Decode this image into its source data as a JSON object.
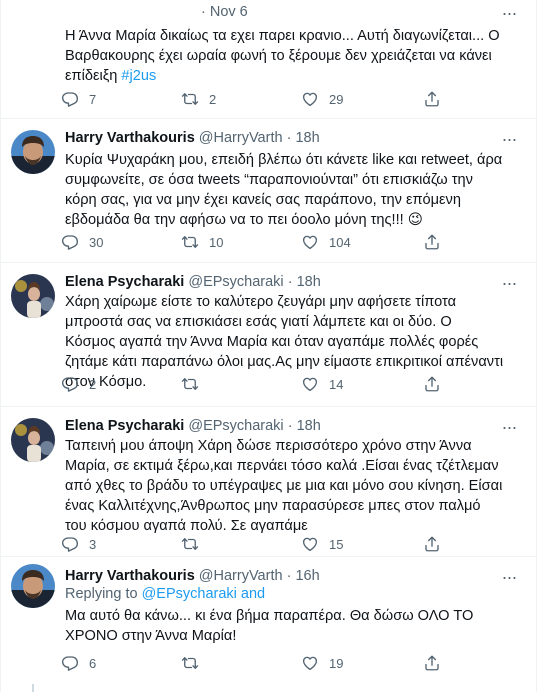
{
  "tweets": [
    {
      "time": "Nov 6",
      "text_before": "Η Άννα Μαρία δικαίως τα εχει παρει κρανιο... Αυτή διαγωνίζεται... Ο Βαρθακουρης έχει ωραία φωνή το ξέρουμε δεν χρειάζεται να κάνει επίδειξη ",
      "hashtag": "#j2us",
      "replies": "7",
      "retweets": "2",
      "likes": "29"
    },
    {
      "name": "Harry Varthakouris",
      "handle": "@HarryVarth",
      "time": "18h",
      "text": "Κυρία Ψυχαράκη μου, επειδή βλέπω ότι κάνετε like και retweet, άρα συμφωνείτε,  σε όσα tweets “παραπονιούνται” ότι επισκιάζω την κόρη σας, για να μην έχει κανείς σας παράπονο, την επόμενη εβδομάδα θα την αφήσω να το πει όοολο μόνη της!!! 😉",
      "replies": "30",
      "retweets": "10",
      "likes": "104"
    },
    {
      "name": "Elena Psycharaki",
      "handle": "@EPsycharaki",
      "time": "18h",
      "text": "Χάρη χαίρωμε είστε το καλύτερο  ζευγάρι μην αφήσετε τίποτα μπροστά σας να επισκιάσει εσάς  γιατί λάμπετε και οι δύο.               Ο Κόσμος αγαπά την Άννα Μαρία και όταν αγαπάμε πολλές φορές ζητάμε κάτι παραπάνω όλοι μας.Ας μην είμαστε επικριτικοί απέναντι στον Κόσμο.",
      "replies": "2",
      "retweets": "",
      "likes": "14"
    },
    {
      "name": "Elena Psycharaki",
      "handle": "@EPsycharaki",
      "time": "18h",
      "text": "Ταπεινή μου άποψη Χάρη δώσε περισσότερο χρόνο στην Άννα Μαρία, σε εκτιμά ξέρω,και περνάει τόσο καλά .Είσαι ένας τζέτλεμαν από χθες το βράδυ το υπέγραψες με μια και μόνο σου κίνηση. Είσαι ένας Καλλιτέχνης,Άνθρωπος μην παρασύρεσε μπες στον παλμό του κόσμου αγαπά πολύ. Σε αγαπάμε",
      "replies": "3",
      "retweets": "",
      "likes": "15"
    },
    {
      "name": "Harry Varthakouris",
      "handle": "@HarryVarth",
      "time": "16h",
      "replying_label": "Replying to ",
      "replying_to": "@EPsycharaki and",
      "text": "Μα αυτό θα κάνω... κι ένα βήμα παραπέρα. Θα δώσω ΟΛΟ ΤΟ ΧΡΟΝΟ στην Άννα Μαρία!",
      "replies": "6",
      "retweets": "",
      "likes": "19"
    }
  ],
  "icons": {
    "reply": "reply-icon",
    "retweet": "retweet-icon",
    "like": "heart-icon",
    "share": "share-icon",
    "more": "more-icon"
  },
  "colors": {
    "link": "#1d9bf0",
    "secondary": "#536471",
    "text": "#0f1419",
    "divider": "#eff3f4"
  }
}
